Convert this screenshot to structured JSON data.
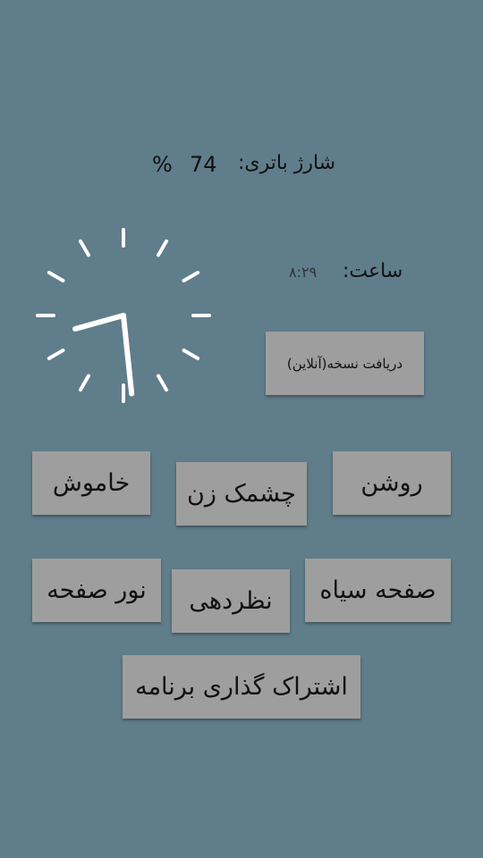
{
  "battery": {
    "label": "شارژ باتری:",
    "value": "74",
    "unit": "%"
  },
  "clock": {
    "label": "ساعت:",
    "time": "۸:۲۹",
    "hour": 8,
    "minute": 29
  },
  "buttons": {
    "get_version": "دریافت نسخه(آنلاین)",
    "on": "روشن",
    "blink": "چشمک زن",
    "off": "خاموش",
    "black_screen": "صفحه سیاه",
    "feedback": "نظردهی",
    "screen_light": "نور صفحه",
    "share_app": "اشتراک گذاری برنامه"
  }
}
